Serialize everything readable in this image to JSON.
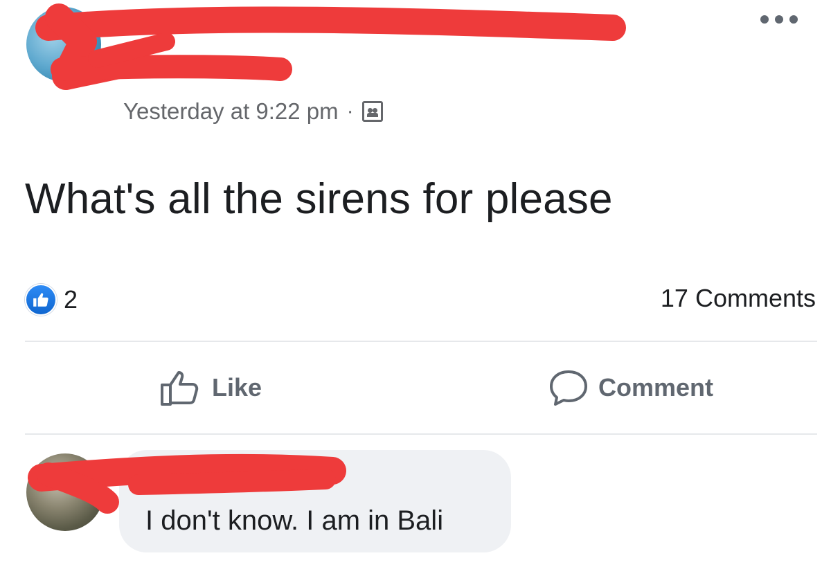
{
  "post": {
    "timestamp": "Yesterday at 9:22 pm",
    "separator": "·",
    "audience_icon": "audience-icon",
    "text": "What's all the sirens for please",
    "reaction_count": "2",
    "comments_count": "17 Comments"
  },
  "actions": {
    "like_label": "Like",
    "comment_label": "Comment"
  },
  "comment": {
    "text": "I don't know. I am in Bali"
  },
  "colors": {
    "redaction": "#ee3b3b",
    "like_blue": "#1877f2",
    "secondary_text": "#65676b",
    "bubble": "#eff1f4"
  }
}
